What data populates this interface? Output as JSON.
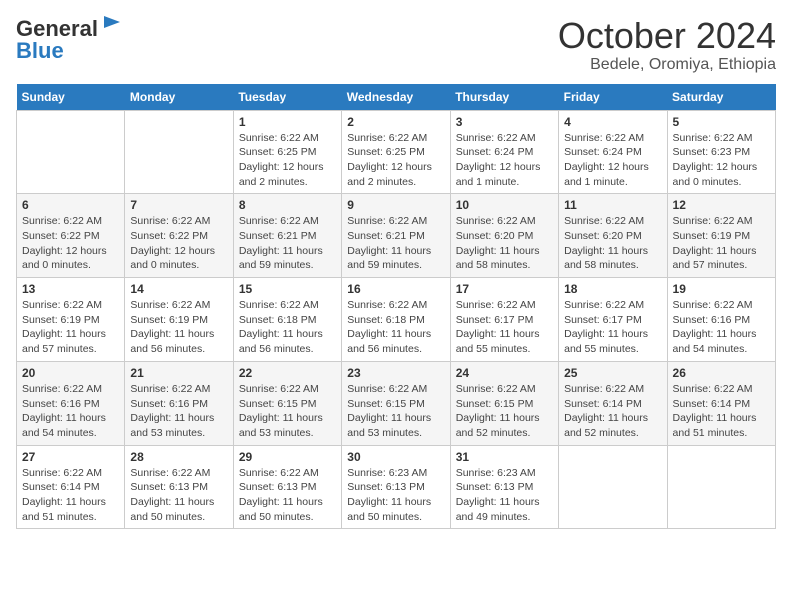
{
  "header": {
    "logo_general": "General",
    "logo_blue": "Blue",
    "title": "October 2024",
    "subtitle": "Bedele, Oromiya, Ethiopia"
  },
  "days_of_week": [
    "Sunday",
    "Monday",
    "Tuesday",
    "Wednesday",
    "Thursday",
    "Friday",
    "Saturday"
  ],
  "weeks": [
    [
      {
        "day": "",
        "sunrise": "",
        "sunset": "",
        "daylight": ""
      },
      {
        "day": "",
        "sunrise": "",
        "sunset": "",
        "daylight": ""
      },
      {
        "day": "1",
        "sunrise": "Sunrise: 6:22 AM",
        "sunset": "Sunset: 6:25 PM",
        "daylight": "Daylight: 12 hours and 2 minutes."
      },
      {
        "day": "2",
        "sunrise": "Sunrise: 6:22 AM",
        "sunset": "Sunset: 6:25 PM",
        "daylight": "Daylight: 12 hours and 2 minutes."
      },
      {
        "day": "3",
        "sunrise": "Sunrise: 6:22 AM",
        "sunset": "Sunset: 6:24 PM",
        "daylight": "Daylight: 12 hours and 1 minute."
      },
      {
        "day": "4",
        "sunrise": "Sunrise: 6:22 AM",
        "sunset": "Sunset: 6:24 PM",
        "daylight": "Daylight: 12 hours and 1 minute."
      },
      {
        "day": "5",
        "sunrise": "Sunrise: 6:22 AM",
        "sunset": "Sunset: 6:23 PM",
        "daylight": "Daylight: 12 hours and 0 minutes."
      }
    ],
    [
      {
        "day": "6",
        "sunrise": "Sunrise: 6:22 AM",
        "sunset": "Sunset: 6:22 PM",
        "daylight": "Daylight: 12 hours and 0 minutes."
      },
      {
        "day": "7",
        "sunrise": "Sunrise: 6:22 AM",
        "sunset": "Sunset: 6:22 PM",
        "daylight": "Daylight: 12 hours and 0 minutes."
      },
      {
        "day": "8",
        "sunrise": "Sunrise: 6:22 AM",
        "sunset": "Sunset: 6:21 PM",
        "daylight": "Daylight: 11 hours and 59 minutes."
      },
      {
        "day": "9",
        "sunrise": "Sunrise: 6:22 AM",
        "sunset": "Sunset: 6:21 PM",
        "daylight": "Daylight: 11 hours and 59 minutes."
      },
      {
        "day": "10",
        "sunrise": "Sunrise: 6:22 AM",
        "sunset": "Sunset: 6:20 PM",
        "daylight": "Daylight: 11 hours and 58 minutes."
      },
      {
        "day": "11",
        "sunrise": "Sunrise: 6:22 AM",
        "sunset": "Sunset: 6:20 PM",
        "daylight": "Daylight: 11 hours and 58 minutes."
      },
      {
        "day": "12",
        "sunrise": "Sunrise: 6:22 AM",
        "sunset": "Sunset: 6:19 PM",
        "daylight": "Daylight: 11 hours and 57 minutes."
      }
    ],
    [
      {
        "day": "13",
        "sunrise": "Sunrise: 6:22 AM",
        "sunset": "Sunset: 6:19 PM",
        "daylight": "Daylight: 11 hours and 57 minutes."
      },
      {
        "day": "14",
        "sunrise": "Sunrise: 6:22 AM",
        "sunset": "Sunset: 6:19 PM",
        "daylight": "Daylight: 11 hours and 56 minutes."
      },
      {
        "day": "15",
        "sunrise": "Sunrise: 6:22 AM",
        "sunset": "Sunset: 6:18 PM",
        "daylight": "Daylight: 11 hours and 56 minutes."
      },
      {
        "day": "16",
        "sunrise": "Sunrise: 6:22 AM",
        "sunset": "Sunset: 6:18 PM",
        "daylight": "Daylight: 11 hours and 56 minutes."
      },
      {
        "day": "17",
        "sunrise": "Sunrise: 6:22 AM",
        "sunset": "Sunset: 6:17 PM",
        "daylight": "Daylight: 11 hours and 55 minutes."
      },
      {
        "day": "18",
        "sunrise": "Sunrise: 6:22 AM",
        "sunset": "Sunset: 6:17 PM",
        "daylight": "Daylight: 11 hours and 55 minutes."
      },
      {
        "day": "19",
        "sunrise": "Sunrise: 6:22 AM",
        "sunset": "Sunset: 6:16 PM",
        "daylight": "Daylight: 11 hours and 54 minutes."
      }
    ],
    [
      {
        "day": "20",
        "sunrise": "Sunrise: 6:22 AM",
        "sunset": "Sunset: 6:16 PM",
        "daylight": "Daylight: 11 hours and 54 minutes."
      },
      {
        "day": "21",
        "sunrise": "Sunrise: 6:22 AM",
        "sunset": "Sunset: 6:16 PM",
        "daylight": "Daylight: 11 hours and 53 minutes."
      },
      {
        "day": "22",
        "sunrise": "Sunrise: 6:22 AM",
        "sunset": "Sunset: 6:15 PM",
        "daylight": "Daylight: 11 hours and 53 minutes."
      },
      {
        "day": "23",
        "sunrise": "Sunrise: 6:22 AM",
        "sunset": "Sunset: 6:15 PM",
        "daylight": "Daylight: 11 hours and 53 minutes."
      },
      {
        "day": "24",
        "sunrise": "Sunrise: 6:22 AM",
        "sunset": "Sunset: 6:15 PM",
        "daylight": "Daylight: 11 hours and 52 minutes."
      },
      {
        "day": "25",
        "sunrise": "Sunrise: 6:22 AM",
        "sunset": "Sunset: 6:14 PM",
        "daylight": "Daylight: 11 hours and 52 minutes."
      },
      {
        "day": "26",
        "sunrise": "Sunrise: 6:22 AM",
        "sunset": "Sunset: 6:14 PM",
        "daylight": "Daylight: 11 hours and 51 minutes."
      }
    ],
    [
      {
        "day": "27",
        "sunrise": "Sunrise: 6:22 AM",
        "sunset": "Sunset: 6:14 PM",
        "daylight": "Daylight: 11 hours and 51 minutes."
      },
      {
        "day": "28",
        "sunrise": "Sunrise: 6:22 AM",
        "sunset": "Sunset: 6:13 PM",
        "daylight": "Daylight: 11 hours and 50 minutes."
      },
      {
        "day": "29",
        "sunrise": "Sunrise: 6:22 AM",
        "sunset": "Sunset: 6:13 PM",
        "daylight": "Daylight: 11 hours and 50 minutes."
      },
      {
        "day": "30",
        "sunrise": "Sunrise: 6:23 AM",
        "sunset": "Sunset: 6:13 PM",
        "daylight": "Daylight: 11 hours and 50 minutes."
      },
      {
        "day": "31",
        "sunrise": "Sunrise: 6:23 AM",
        "sunset": "Sunset: 6:13 PM",
        "daylight": "Daylight: 11 hours and 49 minutes."
      },
      {
        "day": "",
        "sunrise": "",
        "sunset": "",
        "daylight": ""
      },
      {
        "day": "",
        "sunrise": "",
        "sunset": "",
        "daylight": ""
      }
    ]
  ]
}
